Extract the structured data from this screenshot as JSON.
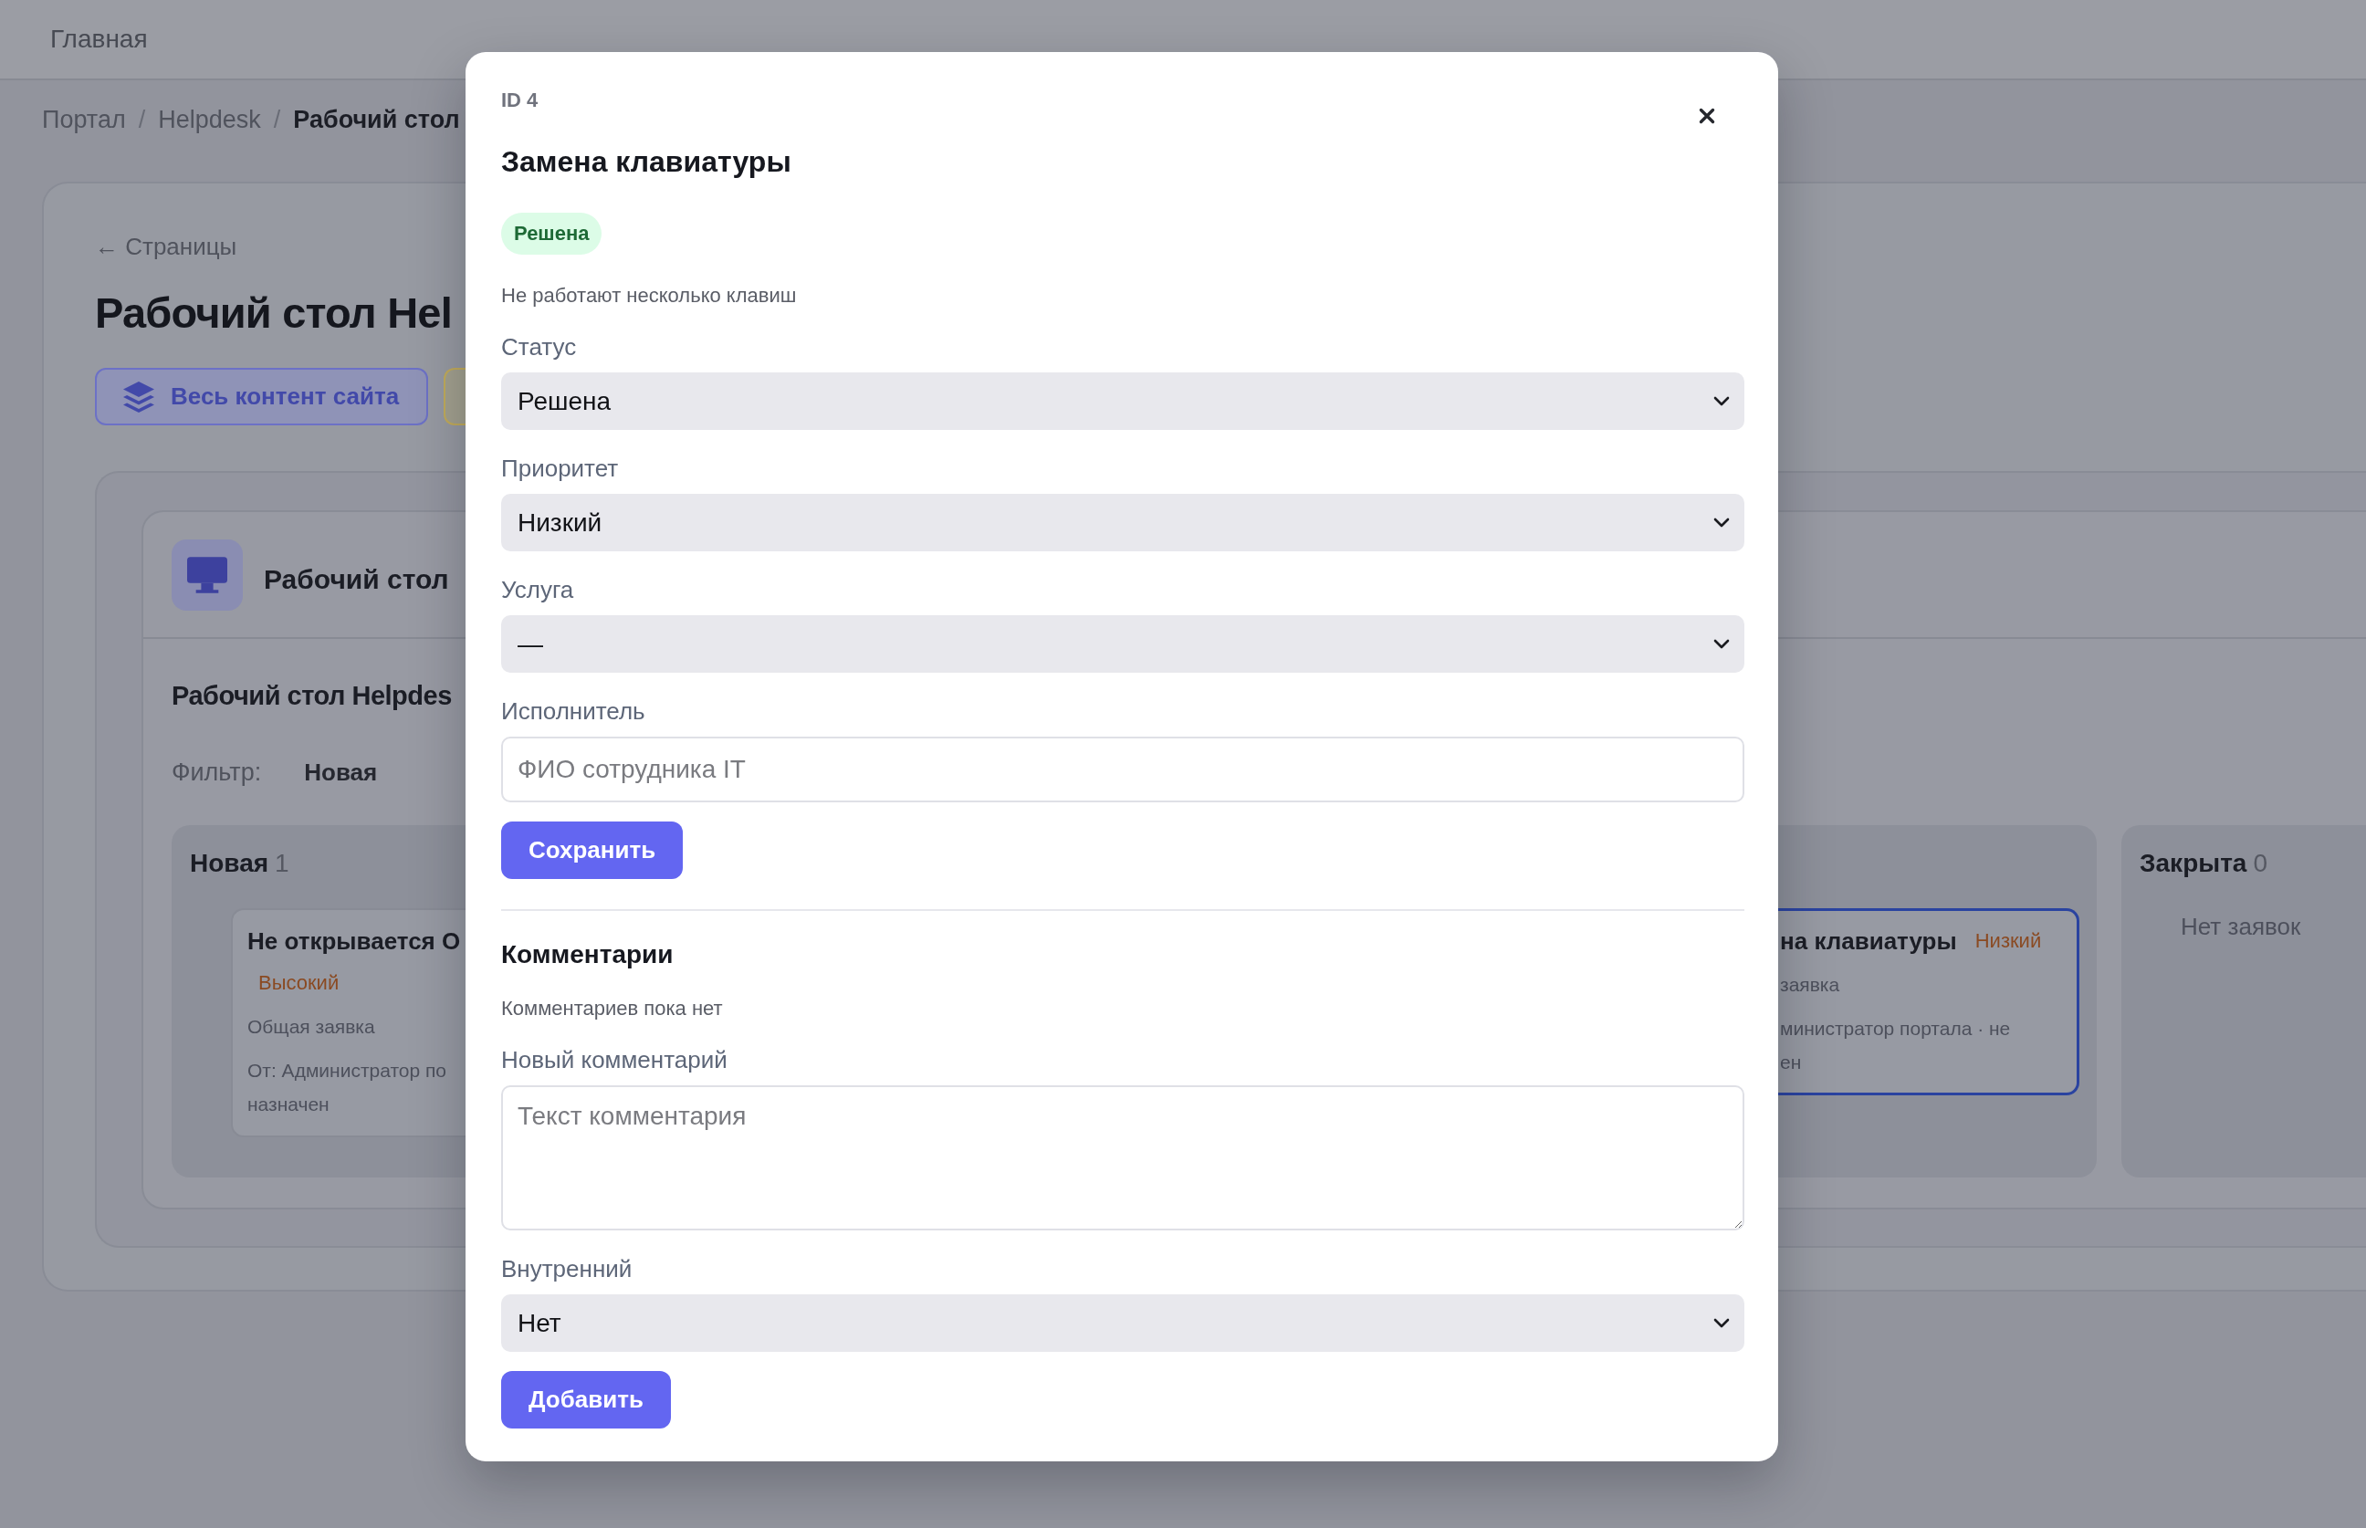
{
  "top_bar": {
    "home_link": "Главная"
  },
  "breadcrumbs": {
    "separator": "/",
    "items": [
      {
        "label": "Портал",
        "current": false
      },
      {
        "label": "Helpdesk",
        "current": false
      },
      {
        "label": "Рабочий стол",
        "current": true
      }
    ]
  },
  "page": {
    "back_link": "← Страницы",
    "title": "Рабочий стол Hel",
    "actions": [
      {
        "label": "Весь контент сайта",
        "color": "#6c71c6"
      },
      {
        "color": "#c3ac5a"
      }
    ],
    "widget": {
      "title": "Рабочий стол",
      "board_title": "Рабочий стол Helpdes",
      "filter_label": "Фильтр:",
      "filters": [
        "Новая"
      ],
      "columns": [
        {
          "title": "Новая",
          "count": "1",
          "cards": [
            {
              "title": "Не открывается О",
              "priority": "Высокий",
              "category": "Общая заявка",
              "author_line": "От: Администратор по",
              "assignee_line": "назначен",
              "selected": false
            }
          ]
        },
        {
          "cards": [
            {
              "title": "на клавиатуры",
              "priority": "Низкий",
              "category": "заявка",
              "author_line": "министратор портала · не",
              "assignee_line": "ен",
              "selected": true
            }
          ]
        },
        {
          "title": "Закрыта",
          "count": "0",
          "empty_text": "Нет заявок"
        }
      ]
    }
  },
  "modal": {
    "id_label": "ID 4",
    "title": "Замена клавиатуры",
    "status_badge": "Решена",
    "description": "Не работают несколько клавиш",
    "fields": [
      {
        "kind": "select",
        "label": "Статус",
        "value": "Решена"
      },
      {
        "kind": "select",
        "label": "Приоритет",
        "value": "Низкий"
      },
      {
        "kind": "select",
        "label": "Услуга",
        "value": "—"
      },
      {
        "kind": "input",
        "label": "Исполнитель",
        "placeholder": "ФИО сотрудника IT"
      }
    ],
    "save_button": "Сохранить",
    "comments": {
      "title": "Комментарии",
      "empty_text": "Комментариев пока нет",
      "fields": [
        {
          "kind": "textarea",
          "label": "Новый комментарий",
          "placeholder": "Текст комментария"
        },
        {
          "kind": "select",
          "label": "Внутренний",
          "value": "Нет"
        }
      ],
      "add_button": "Добавить"
    }
  }
}
